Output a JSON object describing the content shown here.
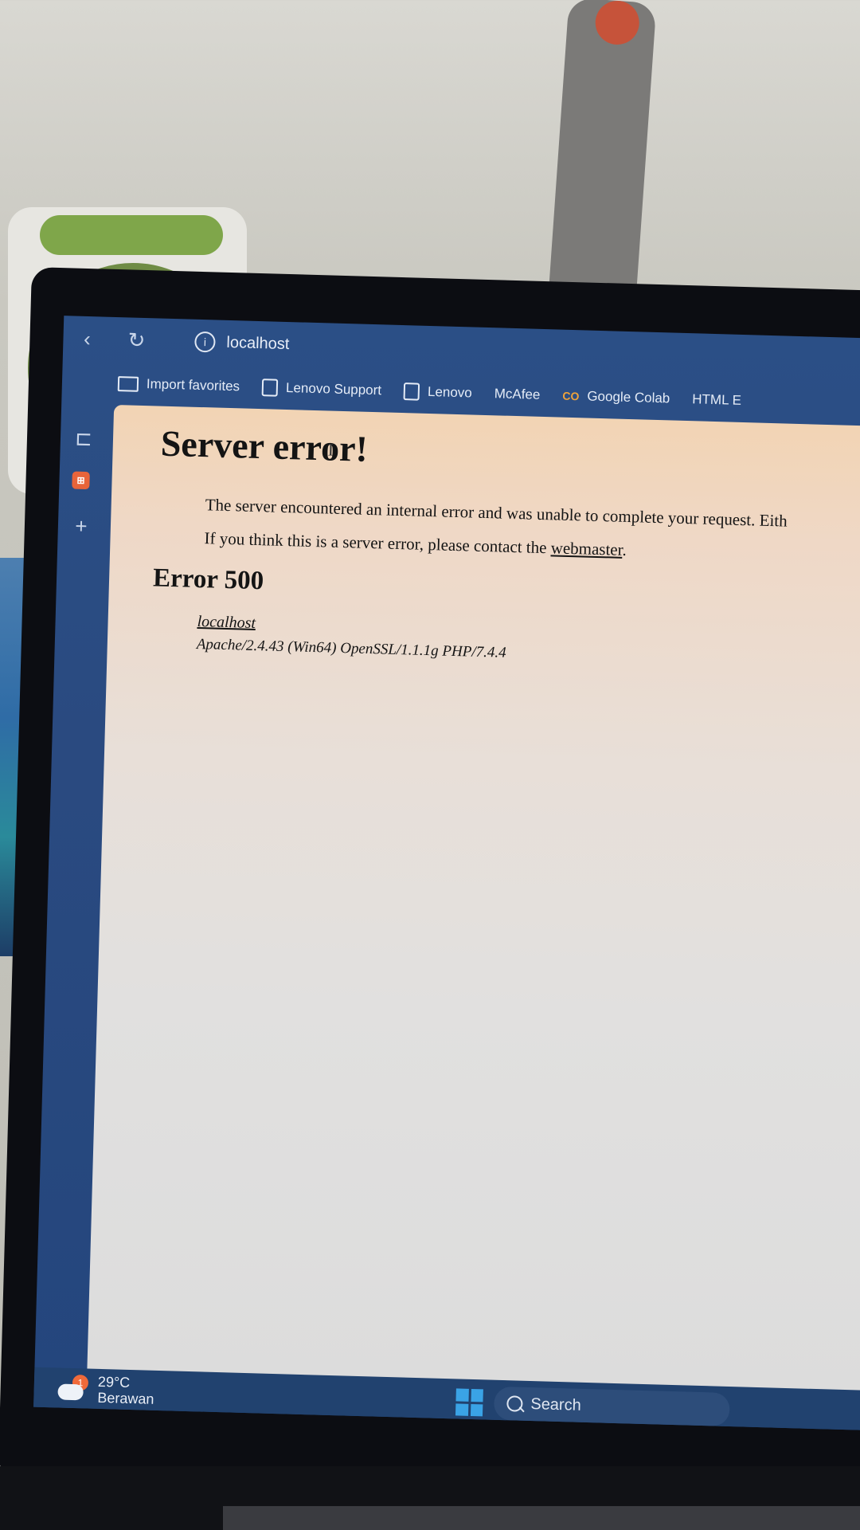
{
  "browser": {
    "address": "localhost",
    "favorites": [
      {
        "label": "Import favorites",
        "icon": "folder-icon"
      },
      {
        "label": "Lenovo Support",
        "icon": "page-icon"
      },
      {
        "label": "Lenovo",
        "icon": "page-icon"
      },
      {
        "label": "McAfee",
        "icon": ""
      },
      {
        "label": "Google Colab",
        "icon": "colab-icon"
      },
      {
        "label": "HTML E",
        "icon": ""
      }
    ]
  },
  "page": {
    "title": "Server error!",
    "message1": "The server encountered an internal error and was unable to complete your request. Eith",
    "message2_prefix": "If you think this is a server error, please contact the ",
    "message2_link": "webmaster",
    "message2_suffix": ".",
    "error_heading": "Error 500",
    "host": "localhost",
    "signature": "Apache/2.4.43 (Win64) OpenSSL/1.1.1g PHP/7.4.4"
  },
  "taskbar": {
    "temperature": "29°C",
    "condition": "Berawan",
    "weather_badge": "1",
    "search_placeholder": "Search"
  },
  "colors": {
    "taskbar": "#21426f",
    "accent": "#3aa3e6"
  }
}
